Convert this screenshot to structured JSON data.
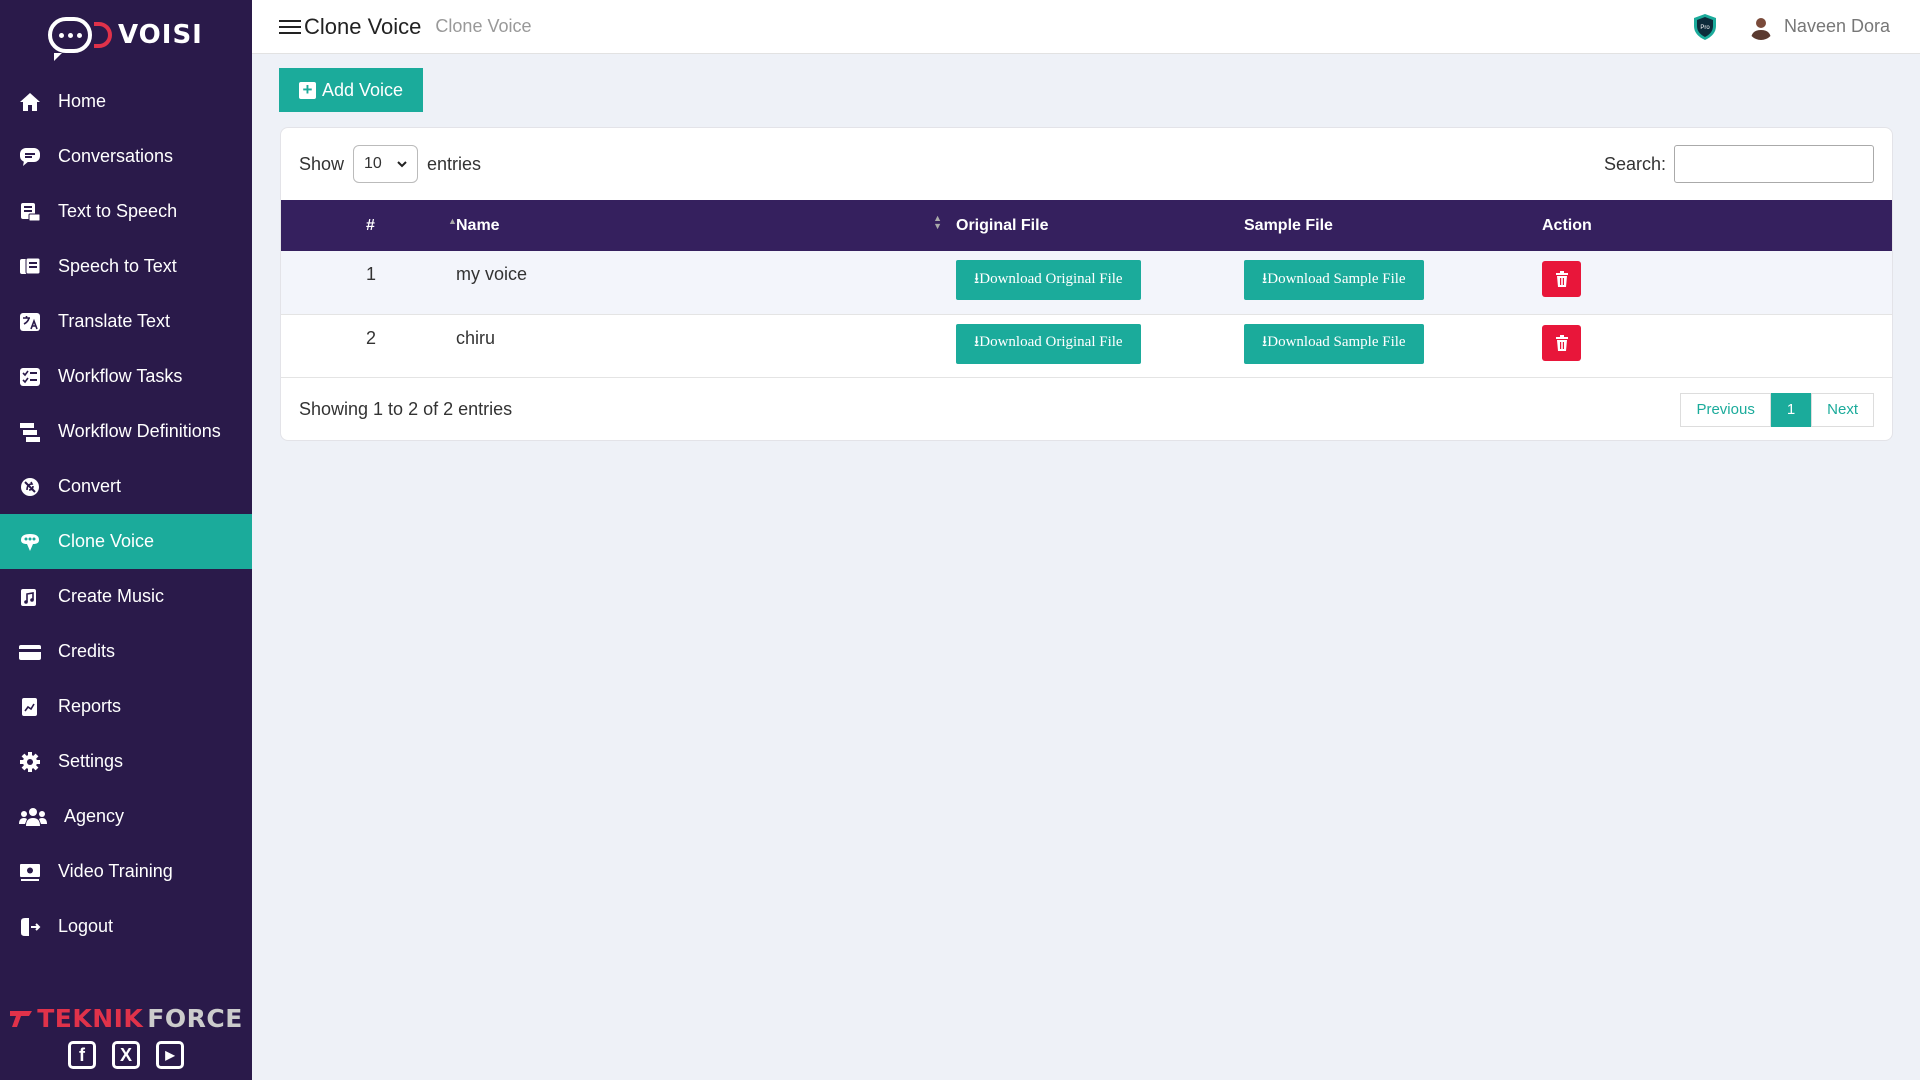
{
  "app": {
    "logo_text": "VOISI",
    "brand_primary": "#2a1a4a",
    "accent": "#1bab9b",
    "danger": "#e8163a"
  },
  "sidebar": {
    "items": [
      {
        "label": "Home",
        "icon": "home-icon"
      },
      {
        "label": "Conversations",
        "icon": "chat-icon"
      },
      {
        "label": "Text to Speech",
        "icon": "text-to-speech-icon"
      },
      {
        "label": "Speech to Text",
        "icon": "speech-to-text-icon"
      },
      {
        "label": "Translate Text",
        "icon": "translate-icon"
      },
      {
        "label": "Workflow Tasks",
        "icon": "tasks-icon"
      },
      {
        "label": "Workflow Definitions",
        "icon": "workflow-icon"
      },
      {
        "label": "Convert",
        "icon": "convert-icon"
      },
      {
        "label": "Clone Voice",
        "icon": "clone-voice-icon",
        "active": true
      },
      {
        "label": "Create Music",
        "icon": "music-icon"
      },
      {
        "label": "Credits",
        "icon": "credit-card-icon"
      },
      {
        "label": "Reports",
        "icon": "reports-icon"
      },
      {
        "label": "Settings",
        "icon": "gear-icon"
      },
      {
        "label": "Agency",
        "icon": "users-icon"
      },
      {
        "label": "Video Training",
        "icon": "video-icon"
      },
      {
        "label": "Logout",
        "icon": "logout-icon"
      }
    ],
    "footer_brand": {
      "part1": "TEKNIK",
      "part2": "FORCE"
    },
    "socials": {
      "facebook": "f",
      "x": "X",
      "youtube": "▶"
    }
  },
  "header": {
    "title": "Clone Voice",
    "breadcrumb": "Clone Voice",
    "user_name": "Naveen Dora",
    "badge": "Pro"
  },
  "main": {
    "add_button": "Add Voice",
    "show_label": "Show",
    "entries_label": "entries",
    "page_length": "10",
    "search_label": "Search:",
    "search_value": "",
    "columns": [
      "#",
      "Name",
      "Original File",
      "Sample File",
      "Action"
    ],
    "rows": [
      {
        "num": "1",
        "name": "my voice",
        "original": "Download Original File",
        "sample": "Download Sample File"
      },
      {
        "num": "2",
        "name": "chiru",
        "original": "Download Original File",
        "sample": "Download Sample File"
      }
    ],
    "info": "Showing 1 to 2 of 2 entries",
    "pager": {
      "prev": "Previous",
      "current": "1",
      "next": "Next"
    }
  }
}
